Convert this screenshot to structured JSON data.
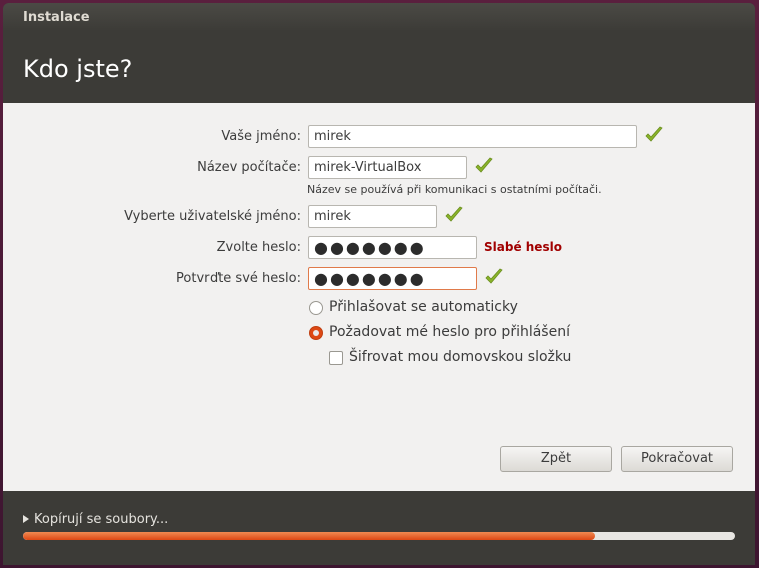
{
  "window": {
    "title": "Instalace"
  },
  "page": {
    "heading": "Kdo jste?"
  },
  "form": {
    "your_name": {
      "label": "Vaše jméno:",
      "value": "mirek"
    },
    "computer_name": {
      "label": "Název počítače:",
      "value": "mirek-VirtualBox",
      "hint": "Název se používá při komunikaci s ostatními počítači."
    },
    "username": {
      "label": "Vyberte uživatelské jméno:",
      "value": "mirek"
    },
    "password": {
      "label": "Zvolte heslo:",
      "value": "●●●●●●●",
      "strength": "Slabé heslo"
    },
    "confirm_password": {
      "label": "Potvrďte své heslo:",
      "value": "●●●●●●●"
    },
    "login_options": [
      {
        "label": "Přihlašovat se automaticky",
        "selected": false
      },
      {
        "label": "Požadovat mé heslo pro přihlášení",
        "selected": true
      }
    ],
    "encrypt_home": {
      "label": "Šifrovat mou domovskou složku",
      "checked": false
    }
  },
  "buttons": {
    "back": "Zpět",
    "continue": "Pokračovat"
  },
  "footer": {
    "status": "Kopírují se soubory...",
    "progress": 0.804
  },
  "colors": {
    "accent": "#dd4814",
    "check": "#8ab42a",
    "weak": "#a10000",
    "dark": "#3c3b37"
  },
  "icons": {
    "valid": "check-icon",
    "expander": "triangle-right-icon"
  }
}
